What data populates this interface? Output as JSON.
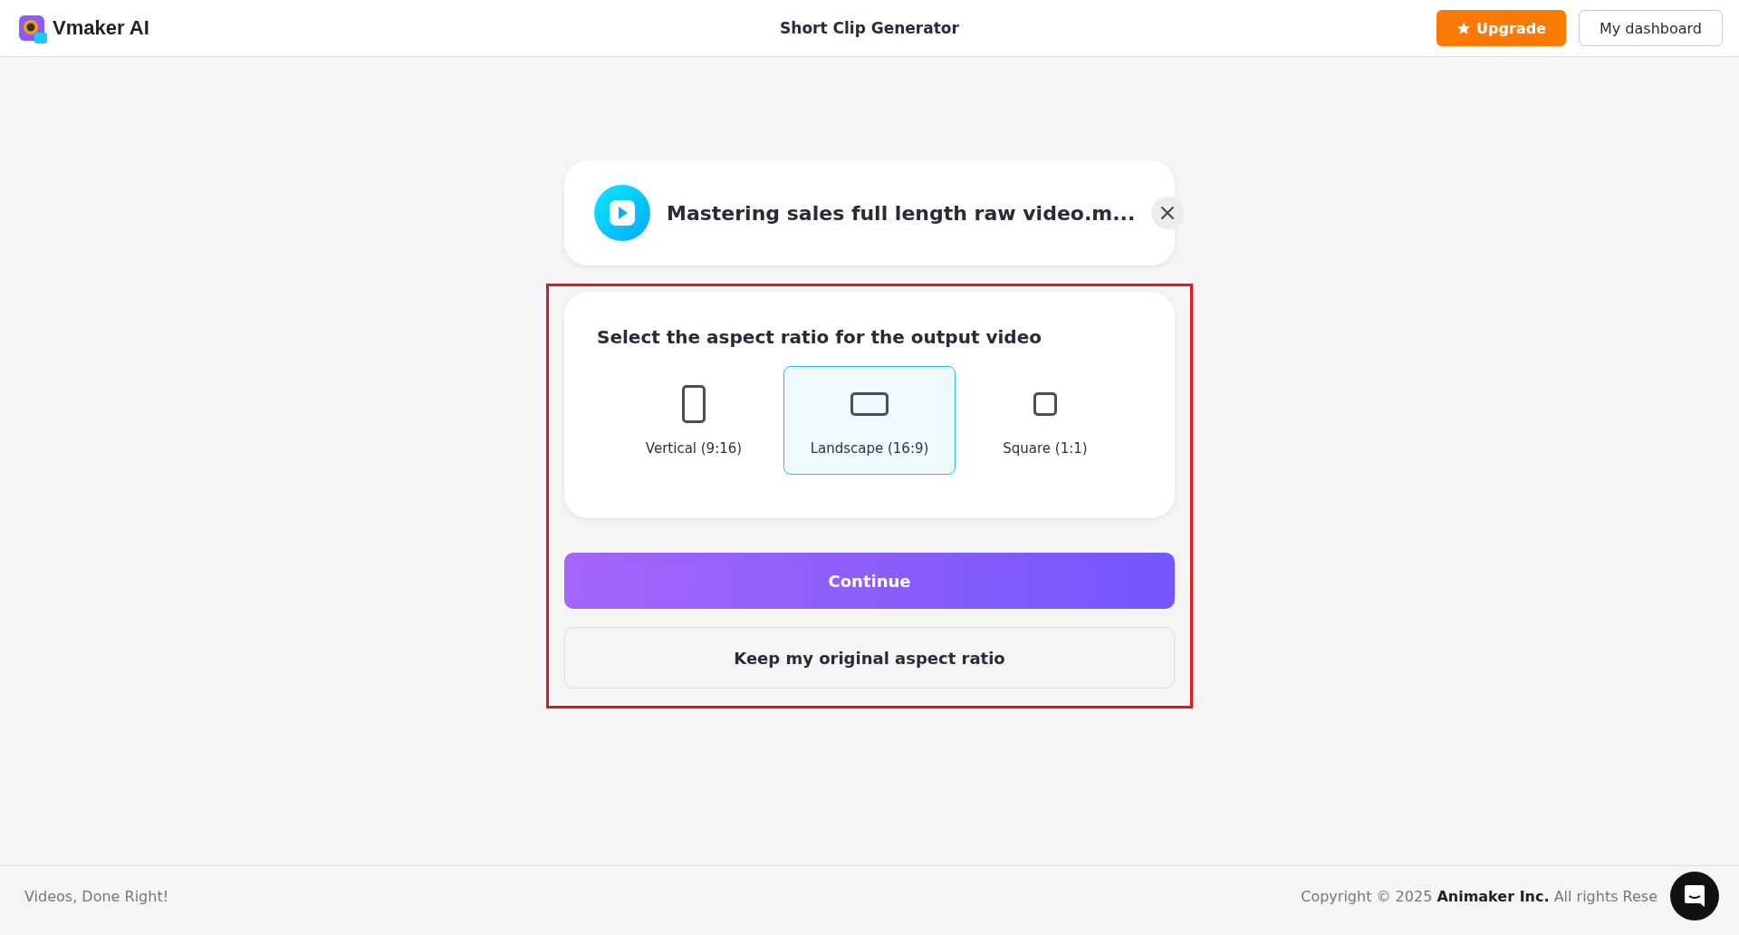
{
  "header": {
    "brand": "Vmaker AI",
    "title": "Short Clip Generator",
    "upgrade_button": "Upgrade",
    "dashboard_button": "My dashboard"
  },
  "file": {
    "name": "Mastering sales full length raw video.m..."
  },
  "aspect": {
    "heading": "Select the aspect ratio for the output video",
    "options": [
      {
        "kind": "vertical",
        "label": "Vertical (9:16)",
        "selected": false
      },
      {
        "kind": "landscape",
        "label": "Landscape (16:9)",
        "selected": true
      },
      {
        "kind": "square",
        "label": "Square (1:1)",
        "selected": false
      }
    ]
  },
  "continue_button": "Continue",
  "keep_button": "Keep my original aspect ratio",
  "footer": {
    "tagline": "Videos, Done Right!",
    "copyright": "Copyright © 2025 **Animaker Inc.** All rights Rese"
  }
}
